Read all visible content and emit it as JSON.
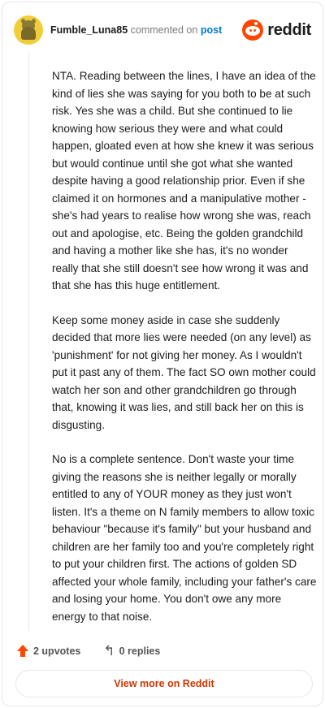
{
  "header": {
    "username": "Fumble_Luna85",
    "verb": "commented on",
    "post_link": "post",
    "brand": "reddit"
  },
  "comment": {
    "paragraphs": [
      "NTA. Reading between the lines, I have an idea of the kind of lies she was saying for you both to be at such risk. Yes she was a child. But she continued to lie knowing how serious they were and what could happen, gloated even at how she knew it was serious but would continue until she got what she wanted despite having a good relationship prior. Even if she claimed it on hormones and a manipulative mother - she's had years to realise how wrong she was, reach out and apologise, etc. Being the golden grandchild and having a mother like she has, it's no wonder really that she still doesn't see how wrong it was and that she has this huge entitlement.",
      "Keep some money aside in case she suddenly decided that more lies were needed (on any level) as 'punishment' for not giving her money. As I wouldn't put it past any of them. The fact SO own mother could watch her son and other grandchildren go through that, knowing it was lies, and still back her on this is disgusting.",
      "No is a complete sentence. Don't waste your time giving the reasons she is neither legally or morally entitled to any of YOUR money as they just won't listen. It's a theme on N family members to allow toxic behaviour \"because it's family\" but your husband and children are her family too and you're completely right to put your children first. The actions of golden SD affected your whole family, including your father's care and losing your home. You don't owe any more energy to that noise."
    ]
  },
  "actions": {
    "upvotes": "2 upvotes",
    "replies": "0 replies"
  },
  "footer": {
    "view_more": "View more on Reddit"
  },
  "colors": {
    "accent": "#ff4500",
    "link": "#0079d3",
    "view_more_text": "#cc3700",
    "avatar_bg": "#f2cd3a"
  },
  "icons": {
    "upvote": "upvote-arrow-icon",
    "reply": "reply-arrow-icon",
    "brand": "reddit-snoo-icon"
  }
}
